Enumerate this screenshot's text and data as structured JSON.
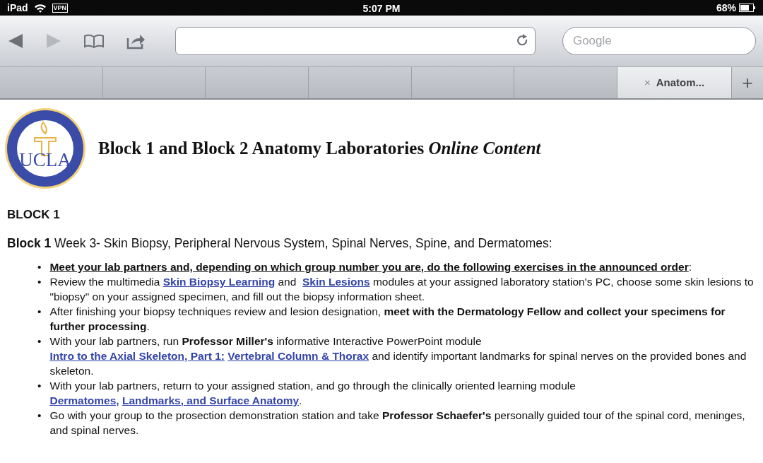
{
  "status_bar": {
    "device": "iPad",
    "vpn": "VPN",
    "time": "5:07 PM",
    "battery": "68%",
    "wifi": true
  },
  "toolbar": {
    "back_disabled": false,
    "forward_disabled": true,
    "search": {
      "placeholder": "Google"
    }
  },
  "tabs": [
    {
      "selected": false
    },
    {
      "selected": false
    },
    {
      "selected": false
    },
    {
      "selected": false
    },
    {
      "selected": false
    },
    {
      "selected": false
    },
    {
      "label": "Anatom...",
      "close": "×",
      "selected": true
    }
  ],
  "new_tab": "+",
  "page": {
    "logo_text": "UCLA",
    "title": "Block 1 and Block 2 Anatomy Laboratories *Online Content*",
    "section": "BLOCK 1",
    "intro": [
      {
        "kind": "bold",
        "text": "Block 1"
      },
      {
        "kind": "plain",
        "text": " Week 3- Skin Biopsy, Peripheral Nervous System, Spinal Nerves, Spine, and Dermatomes:"
      }
    ],
    "bullet_marker": "•",
    "bullets": [
      [
        {
          "kind": "underline",
          "text": "Meet your lab partners and, depending on which group number you are, do the following exercises in the announced order"
        },
        {
          "kind": "plain",
          "text": ":"
        }
      ],
      [
        {
          "kind": "plain",
          "text": "Review the multimedia "
        },
        {
          "kind": "link",
          "text": "Skin Biopsy Learning"
        },
        {
          "kind": "plain",
          "text": " and "
        },
        {
          "kind": "link",
          "text": "Skin Lesions"
        },
        {
          "kind": "plain",
          "text": " modules at your assigned laboratory station's PC, choose some skin lesions to \"biopsy\" on your assigned specimen, and fill out the biopsy information sheet."
        }
      ],
      [
        {
          "kind": "plain",
          "text": "After finishing your biopsy techniques review and lesion designation, "
        },
        {
          "kind": "bold",
          "text": "meet with the Dermatology Fellow and collect your specimens for further processing"
        },
        {
          "kind": "plain",
          "text": "."
        }
      ],
      [
        {
          "kind": "plain",
          "text": "With your lab partners, run "
        },
        {
          "kind": "bold",
          "text": "Professor Miller's"
        },
        {
          "kind": "plain",
          "text": " informative Interactive PowerPoint module "
        },
        {
          "kind": "link",
          "text": "Intro to the Axial Skeleton, Part 1:"
        },
        {
          "kind": "link",
          "text": "Vertebral Column & Thorax"
        },
        {
          "kind": "plain",
          "text": " and identify important landmarks for spinal nerves on the provided bones and skeleton."
        }
      ],
      [
        {
          "kind": "plain",
          "text": "With your lab partners, return to your assigned station, and go through the clinically oriented learning module "
        },
        {
          "kind": "link",
          "text": "Dermatomes,"
        },
        {
          "kind": "link",
          "text": "Landmarks, and Surface Anatomy"
        },
        {
          "kind": "plain",
          "text": "."
        }
      ],
      [
        {
          "kind": "plain",
          "text": "Go with your group to the prosection demonstration station and take "
        },
        {
          "kind": "bold",
          "text": "Professor Schaefer's"
        },
        {
          "kind": "plain",
          "text": " personally guided tour of the spinal cord, meninges, and spinal nerves."
        }
      ]
    ]
  }
}
